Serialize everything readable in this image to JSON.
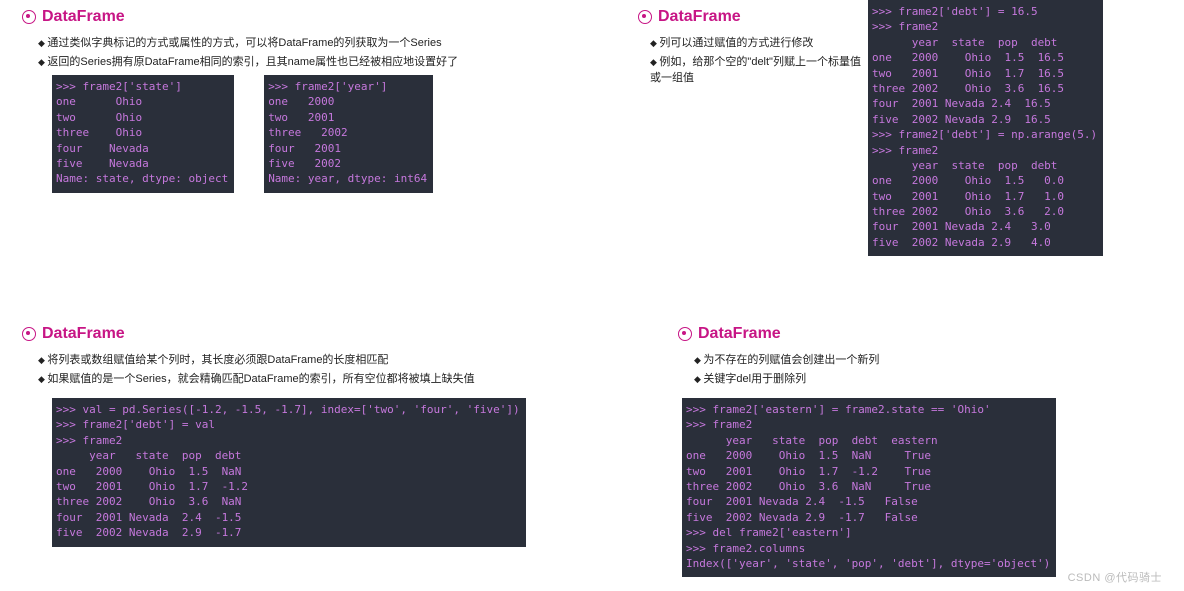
{
  "watermark": "CSDN @代码骑士",
  "sections": {
    "s1": {
      "title": "DataFrame",
      "bullets": [
        "通过类似字典标记的方式或属性的方式，可以将DataFrame的列获取为一个Series",
        "返回的Series拥有原DataFrame相同的索引，且其name属性也已经被相应地设置好了"
      ],
      "code1": ">>> frame2['state']\none      Ohio\ntwo      Ohio\nthree    Ohio\nfour    Nevada\nfive    Nevada\nName: state, dtype: object",
      "code2": ">>> frame2['year']\none   2000\ntwo   2001\nthree   2002\nfour   2001\nfive   2002\nName: year, dtype: int64"
    },
    "s2": {
      "title": "DataFrame",
      "bullets": [
        "列可以通过赋值的方式进行修改",
        "例如，给那个空的\"delt\"列赋上一个标量值或一组值"
      ],
      "code": ">>> frame2['debt'] = 16.5\n>>> frame2\n      year  state  pop  debt\none   2000    Ohio  1.5  16.5\ntwo   2001    Ohio  1.7  16.5\nthree 2002    Ohio  3.6  16.5\nfour  2001 Nevada 2.4  16.5\nfive  2002 Nevada 2.9  16.5\n>>> frame2['debt'] = np.arange(5.)\n>>> frame2\n      year  state  pop  debt\none   2000    Ohio  1.5   0.0\ntwo   2001    Ohio  1.7   1.0\nthree 2002    Ohio  3.6   2.0\nfour  2001 Nevada 2.4   3.0\nfive  2002 Nevada 2.9   4.0"
    },
    "s3": {
      "title": "DataFrame",
      "bullets": [
        "将列表或数组赋值给某个列时，其长度必须跟DataFrame的长度相匹配",
        "如果赋值的是一个Series，就会精确匹配DataFrame的索引，所有空位都将被填上缺失值"
      ],
      "code": ">>> val = pd.Series([-1.2, -1.5, -1.7], index=['two', 'four', 'five'])\n>>> frame2['debt'] = val\n>>> frame2\n     year   state  pop  debt\none   2000    Ohio  1.5  NaN\ntwo   2001    Ohio  1.7  -1.2\nthree 2002    Ohio  3.6  NaN\nfour  2001 Nevada  2.4  -1.5\nfive  2002 Nevada  2.9  -1.7"
    },
    "s4": {
      "title": "DataFrame",
      "bullets": [
        "为不存在的列赋值会创建出一个新列",
        "关键字del用于删除列"
      ],
      "code": ">>> frame2['eastern'] = frame2.state == 'Ohio'\n>>> frame2\n      year   state  pop  debt  eastern\none   2000    Ohio  1.5  NaN     True\ntwo   2001    Ohio  1.7  -1.2    True\nthree 2002    Ohio  3.6  NaN     True\nfour  2001 Nevada 2.4  -1.5   False\nfive  2002 Nevada 2.9  -1.7   False\n>>> del frame2['eastern']\n>>> frame2.columns\nIndex(['year', 'state', 'pop', 'debt'], dtype='object')"
    }
  }
}
